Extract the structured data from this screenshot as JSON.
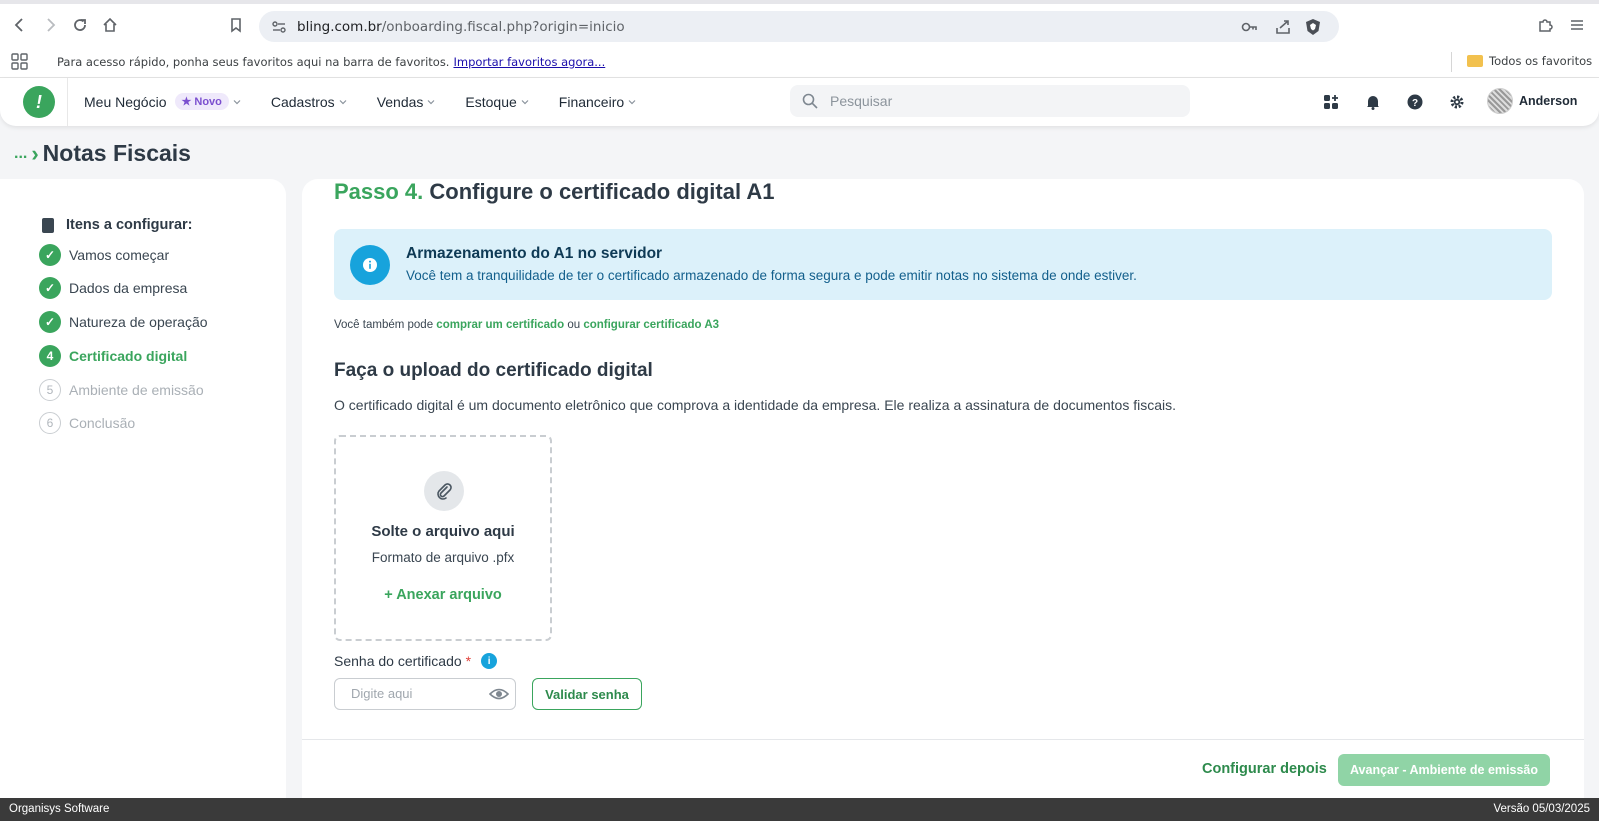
{
  "browser": {
    "url_host": "bling.com.br",
    "url_path": "/onboarding.fiscal.php?origin=inicio",
    "bookmarks_hint": "Para acesso rápido, ponha seus favoritos aqui na barra de favoritos.",
    "bookmarks_import_link": "Importar favoritos agora...",
    "all_bookmarks": "Todos os favoritos"
  },
  "header": {
    "menu": [
      {
        "label": "Meu Negócio"
      },
      {
        "label": "Cadastros"
      },
      {
        "label": "Vendas"
      },
      {
        "label": "Estoque"
      },
      {
        "label": "Financeiro"
      }
    ],
    "novo_badge": "Novo",
    "search_placeholder": "Pesquisar",
    "user_name": "Anderson"
  },
  "breadcrumb": {
    "ellipsis": "...",
    "title": "Notas Fiscais"
  },
  "sidebar": {
    "heading": "Itens a configurar:",
    "steps": [
      {
        "marker": "✓",
        "label": "Vamos começar",
        "state": "done"
      },
      {
        "marker": "✓",
        "label": "Dados da empresa",
        "state": "done"
      },
      {
        "marker": "✓",
        "label": "Natureza de operação",
        "state": "done"
      },
      {
        "marker": "4",
        "label": "Certificado digital",
        "state": "current"
      },
      {
        "marker": "5",
        "label": "Ambiente de emissão",
        "state": "todo"
      },
      {
        "marker": "6",
        "label": "Conclusão",
        "state": "todo"
      }
    ]
  },
  "main": {
    "step_number": "Passo 4.",
    "step_title": "Configure o certificado digital A1",
    "info_title": "Armazenamento do A1 no servidor",
    "info_text": "Você tem a tranquilidade de ter o certificado armazenado de forma segura e pode emitir notas no sistema de onde estiver.",
    "also_prefix": "Você também pode",
    "buy_link": "comprar um certificado",
    "also_or": "ou",
    "a3_link": "configurar certificado A3",
    "upload_title": "Faça o upload do certificado digital",
    "upload_desc": "O certificado digital é um documento eletrônico que comprova a identidade da empresa. Ele realiza a assinatura de documentos fiscais.",
    "drop_title": "Solte o arquivo aqui",
    "drop_format": "Formato de arquivo .pfx",
    "attach_label": "Anexar arquivo",
    "password_label": "Senha do certificado",
    "password_required": "*",
    "password_placeholder": "Digite aqui",
    "validate_button": "Validar senha",
    "later_link": "Configurar depois",
    "next_button": "Avançar - Ambiente de emissão"
  },
  "footer": {
    "left": "Organisys Software",
    "right": "Versão 05/03/2025"
  },
  "colors": {
    "brand_green": "#3aa55d",
    "info_blue": "#17a3dc",
    "info_bg": "#dcf1fa"
  }
}
